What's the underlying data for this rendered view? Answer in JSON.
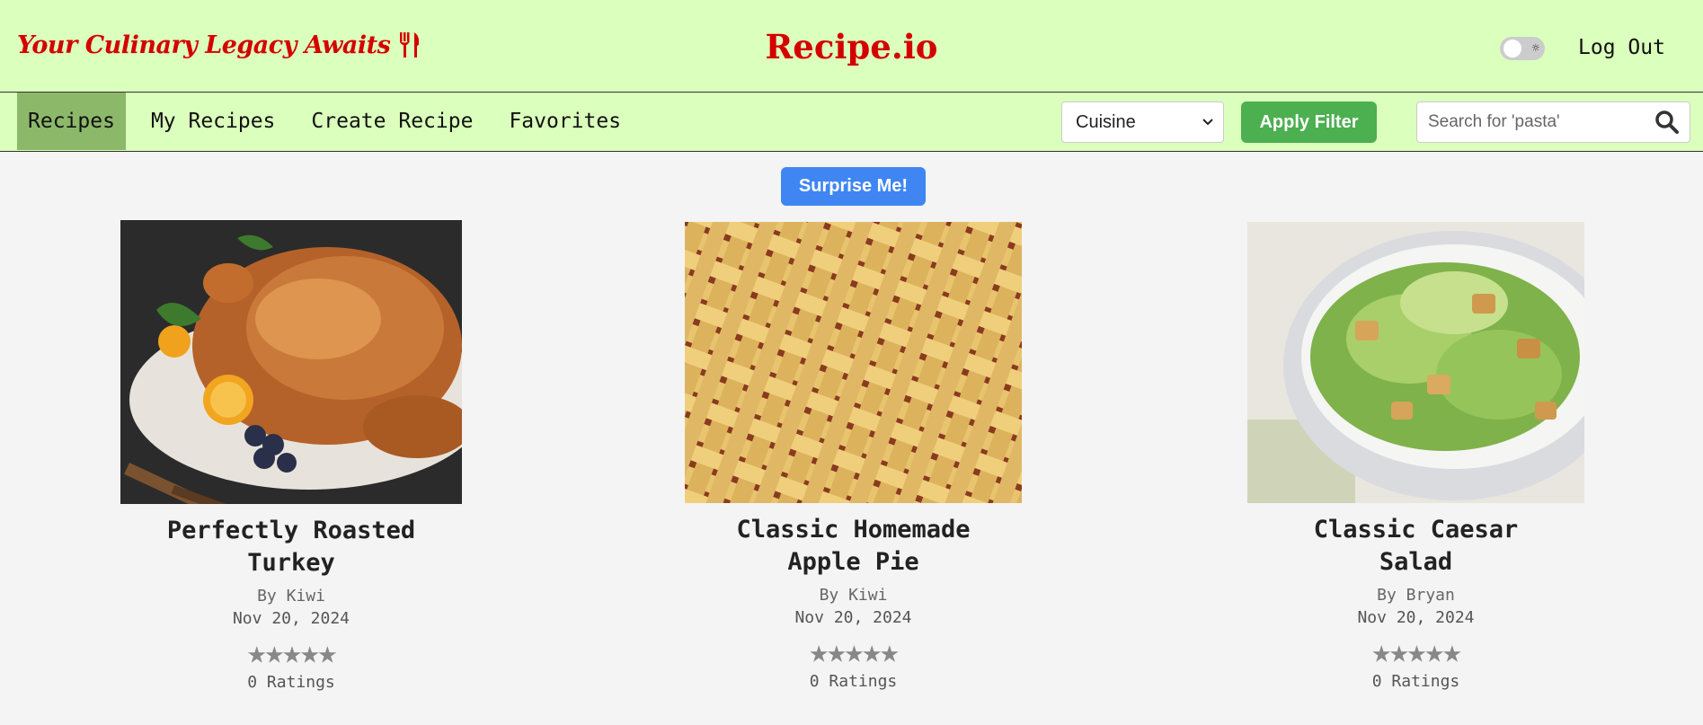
{
  "header": {
    "tagline": "Your Culinary Legacy Awaits",
    "brand": "Recipe.io",
    "logout_label": "Log Out",
    "theme_toggle_icon": "sun-icon"
  },
  "nav": {
    "items": [
      {
        "label": "Recipes",
        "active": true
      },
      {
        "label": "My Recipes"
      },
      {
        "label": "Create Recipe"
      },
      {
        "label": "Favorites"
      }
    ]
  },
  "filters": {
    "cuisine_value": "Cuisine",
    "apply_label": "Apply Filter",
    "search_placeholder": "Search for 'pasta'"
  },
  "surprise_label": "Surprise Me!",
  "recipes": [
    {
      "title_line1": "Perfectly Roasted",
      "title_line2": "Turkey",
      "author": "By Kiwi",
      "date": "Nov 20, 2024",
      "stars": "★★★★★",
      "rating_value": 0,
      "ratings": "0 Ratings"
    },
    {
      "title_line1": "Classic Homemade",
      "title_line2": "Apple Pie",
      "author": "By Kiwi",
      "date": "Nov 20, 2024",
      "stars": "★★★★★",
      "rating_value": 0,
      "ratings": "0 Ratings"
    },
    {
      "title_line1": "Classic Caesar",
      "title_line2": "Salad",
      "author": "By Bryan",
      "date": "Nov 20, 2024",
      "stars": "★★★★★",
      "rating_value": 0,
      "ratings": "0 Ratings"
    }
  ],
  "colors": {
    "header_bg": "#dbffbc",
    "brand_red": "#d40000",
    "active_nav": "#8cb86a",
    "apply_green": "#4caf50",
    "surprise_blue": "#3f86f2",
    "star_gray": "#888888"
  }
}
